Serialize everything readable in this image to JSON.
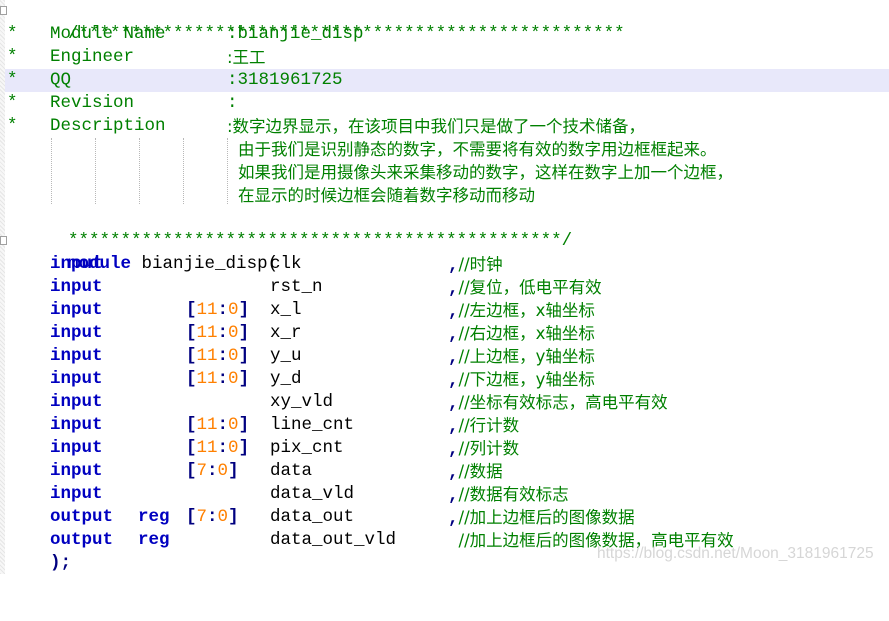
{
  "header_comment": {
    "top_border": "/****************************************************",
    "bottom_border": "***********************************************/",
    "star": "*",
    "fields": [
      {
        "label": "Module Name",
        "value": ":bianjie_disp"
      },
      {
        "label": "Engineer",
        "value": ":王工"
      },
      {
        "label": "QQ",
        "value": ":3181961725"
      },
      {
        "label": "Revision",
        "value": ":"
      },
      {
        "label": "Description",
        "value": ":数字边界显示，在该项目中我们只是做了一个技术储备，"
      }
    ],
    "description_continuation": [
      "由于我们是识别静态的数字，不需要将有效的数字用边框框起来。",
      "如果我们是用摄像头来采集移动的数字，这样在数字上加一个边框，",
      "在显示的时候边框会随着数字移动而移动"
    ]
  },
  "module_decl": {
    "keyword": "module",
    "name": "bianjie_disp(",
    "close": ");"
  },
  "ports": [
    {
      "dir": "input",
      "reg": "",
      "width_hi": "",
      "width_lo": "",
      "name": "clk",
      "sep": ",",
      "comment": "//时钟"
    },
    {
      "dir": "input",
      "reg": "",
      "width_hi": "",
      "width_lo": "",
      "name": "rst_n",
      "sep": ",",
      "comment": "//复位，低电平有效"
    },
    {
      "dir": "input",
      "reg": "",
      "width_hi": "11",
      "width_lo": "0",
      "name": "x_l",
      "sep": ",",
      "comment": "//左边框，x轴坐标"
    },
    {
      "dir": "input",
      "reg": "",
      "width_hi": "11",
      "width_lo": "0",
      "name": "x_r",
      "sep": ",",
      "comment": "//右边框，x轴坐标"
    },
    {
      "dir": "input",
      "reg": "",
      "width_hi": "11",
      "width_lo": "0",
      "name": "y_u",
      "sep": ",",
      "comment": "//上边框，y轴坐标"
    },
    {
      "dir": "input",
      "reg": "",
      "width_hi": "11",
      "width_lo": "0",
      "name": "y_d",
      "sep": ",",
      "comment": "//下边框，y轴坐标"
    },
    {
      "dir": "input",
      "reg": "",
      "width_hi": "",
      "width_lo": "",
      "name": "xy_vld",
      "sep": ",",
      "comment": "//坐标有效标志，高电平有效"
    },
    {
      "dir": "input",
      "reg": "",
      "width_hi": "11",
      "width_lo": "0",
      "name": "line_cnt",
      "sep": ",",
      "comment": "//行计数"
    },
    {
      "dir": "input",
      "reg": "",
      "width_hi": "11",
      "width_lo": "0",
      "name": "pix_cnt",
      "sep": ",",
      "comment": "//列计数"
    },
    {
      "dir": "input",
      "reg": "",
      "width_hi": "7",
      "width_lo": "0",
      "name": "data",
      "sep": ",",
      "comment": "//数据"
    },
    {
      "dir": "input",
      "reg": "",
      "width_hi": "",
      "width_lo": "",
      "name": "data_vld",
      "sep": ",",
      "comment": "//数据有效标志"
    },
    {
      "dir": "output",
      "reg": "reg",
      "width_hi": "7",
      "width_lo": "0",
      "name": "data_out",
      "sep": ",",
      "comment": "//加上边框后的图像数据"
    },
    {
      "dir": "output",
      "reg": "reg",
      "width_hi": "",
      "width_lo": "",
      "name": "data_out_vld",
      "sep": "",
      "comment": "//加上边框后的图像数据，高电平有效"
    }
  ],
  "syntax_colors": {
    "comment": "#008000",
    "keyword": "#0000c0",
    "bracket": "#000080",
    "number": "#ff8000",
    "current_line": "#e8e8fa"
  },
  "watermark": "https://blog.csdn.net/Moon_3181961725"
}
